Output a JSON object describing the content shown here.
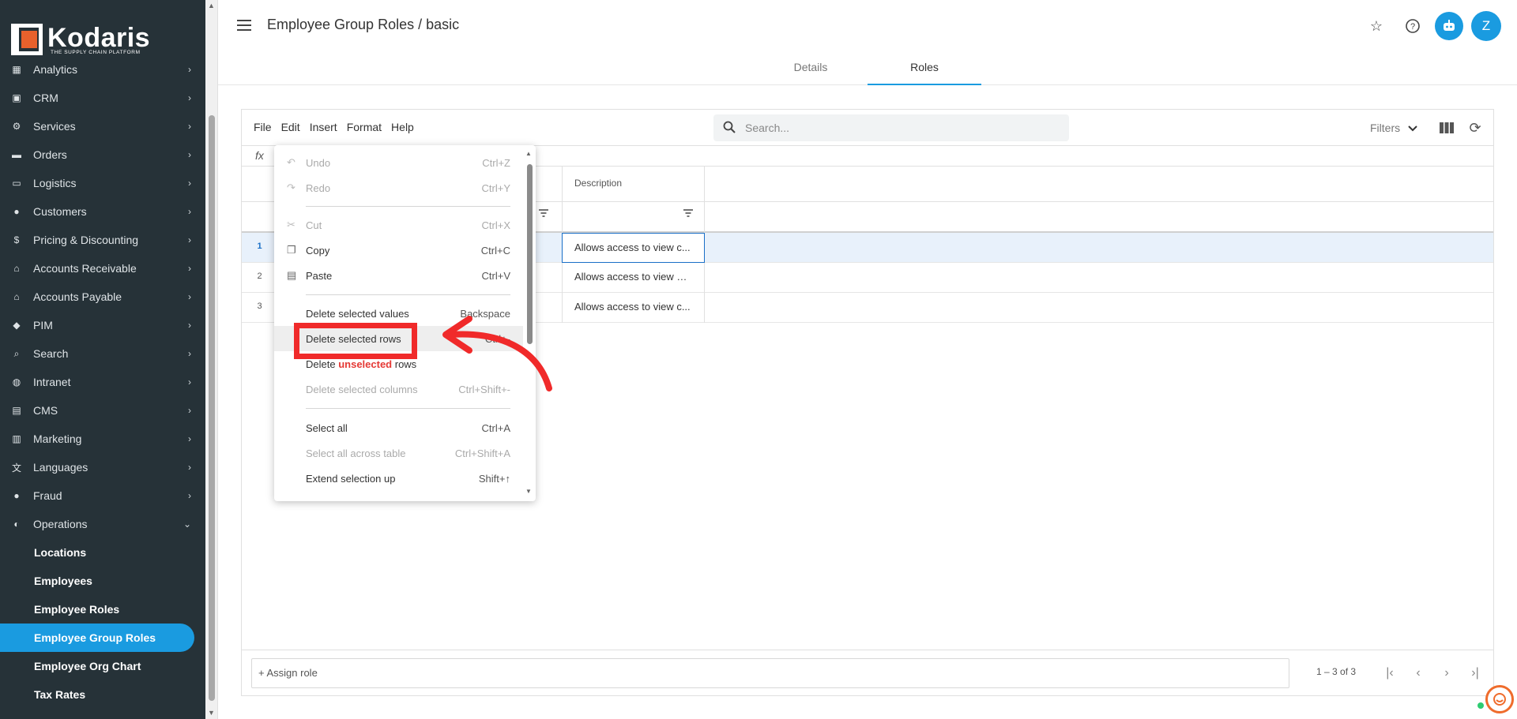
{
  "brand": {
    "name": "Kodaris",
    "tagline": "THE SUPPLY CHAIN PLATFORM",
    "accent": "#1a9be0",
    "logo_color": "#e8612c"
  },
  "sidebar": {
    "items": [
      {
        "label": "Analytics",
        "icon": "chart-icon"
      },
      {
        "label": "CRM",
        "icon": "contact-icon"
      },
      {
        "label": "Services",
        "icon": "services-icon"
      },
      {
        "label": "Orders",
        "icon": "truck-icon"
      },
      {
        "label": "Logistics",
        "icon": "logistics-icon"
      },
      {
        "label": "Customers",
        "icon": "people-icon"
      },
      {
        "label": "Pricing & Discounting",
        "icon": "dollar-icon"
      },
      {
        "label": "Accounts Receivable",
        "icon": "bank-icon"
      },
      {
        "label": "Accounts Payable",
        "icon": "bank-icon"
      },
      {
        "label": "PIM",
        "icon": "tag-icon"
      },
      {
        "label": "Search",
        "icon": "search-icon"
      },
      {
        "label": "Intranet",
        "icon": "globe-icon"
      },
      {
        "label": "CMS",
        "icon": "cms-icon"
      },
      {
        "label": "Marketing",
        "icon": "marketing-icon"
      },
      {
        "label": "Languages",
        "icon": "translate-icon"
      },
      {
        "label": "Fraud",
        "icon": "alert-icon"
      },
      {
        "label": "Operations",
        "icon": "operations-icon"
      }
    ],
    "sub_items": [
      {
        "label": "Locations"
      },
      {
        "label": "Employees"
      },
      {
        "label": "Employee Roles"
      },
      {
        "label": "Employee Group Roles",
        "active": true
      },
      {
        "label": "Employee Org Chart"
      },
      {
        "label": "Tax Rates"
      }
    ]
  },
  "header": {
    "title": "Employee Group Roles / basic",
    "avatar_letter": "Z",
    "tabs": [
      {
        "label": "Details"
      },
      {
        "label": "Roles",
        "active": true
      }
    ]
  },
  "toolbar": {
    "menu": [
      "File",
      "Edit",
      "Insert",
      "Format",
      "Help"
    ],
    "search_placeholder": "Search...",
    "filters_label": "Filters",
    "fx_label": "fx"
  },
  "grid": {
    "columns": [
      {
        "header": "Description"
      }
    ],
    "rows": [
      {
        "num": "1",
        "description": "Allows access to view c...",
        "selected": true
      },
      {
        "num": "2",
        "description": "Allows access to view pr..."
      },
      {
        "num": "3",
        "description": "Allows access to view c..."
      }
    ],
    "assign_label": "+ Assign role",
    "pager_text": "1 – 3 of 3"
  },
  "context_menu": {
    "items": [
      {
        "label": "Undo",
        "shortcut": "Ctrl+Z",
        "disabled": true,
        "icon": "undo-icon"
      },
      {
        "label": "Redo",
        "shortcut": "Ctrl+Y",
        "disabled": true,
        "icon": "redo-icon"
      },
      {
        "label": "Cut",
        "shortcut": "Ctrl+X",
        "disabled": true,
        "icon": "scissors-icon"
      },
      {
        "label": "Copy",
        "shortcut": "Ctrl+C",
        "icon": "copy-icon"
      },
      {
        "label": "Paste",
        "shortcut": "Ctrl+V",
        "icon": "paste-icon"
      },
      {
        "label": "Delete selected values",
        "shortcut": "Backspace"
      },
      {
        "label": "Delete selected rows",
        "shortcut": "Ctrl+-"
      },
      {
        "label_prefix": "Delete ",
        "label_emph": "unselected",
        "label_suffix": " rows"
      },
      {
        "label": "Delete selected columns",
        "shortcut": "Ctrl+Shift+-",
        "disabled": true
      },
      {
        "label": "Select all",
        "shortcut": "Ctrl+A"
      },
      {
        "label": "Select all across table",
        "shortcut": "Ctrl+Shift+A",
        "disabled": true
      },
      {
        "label": "Extend selection up",
        "shortcut": "Shift+↑"
      }
    ]
  },
  "annotation": {
    "highlight_color": "#f02a2a"
  }
}
